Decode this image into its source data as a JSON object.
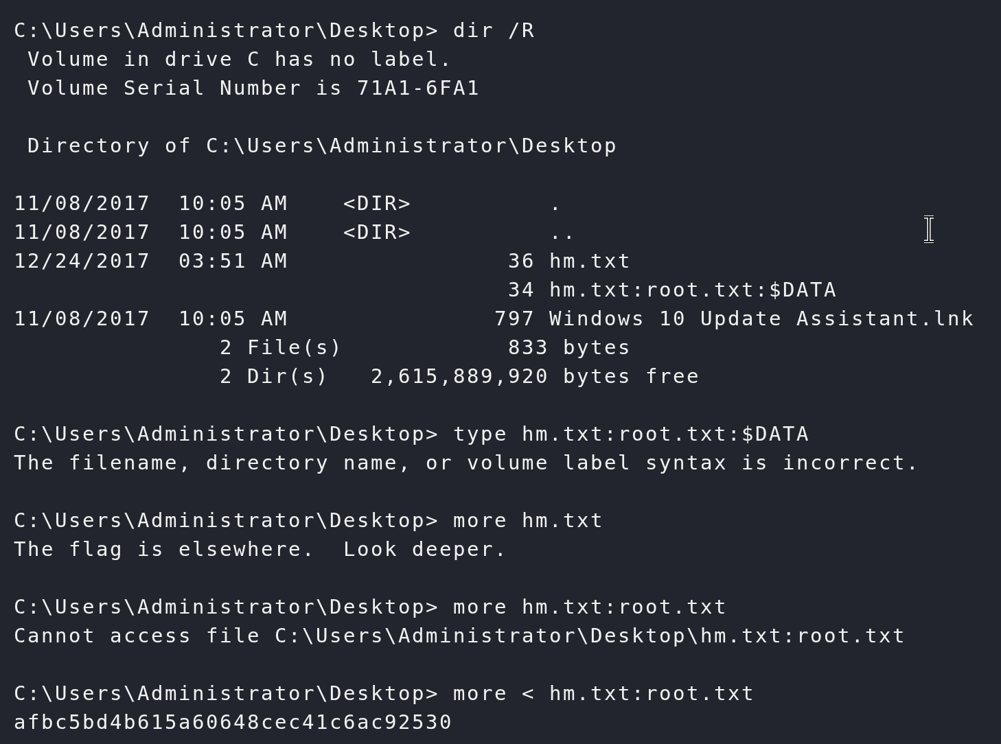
{
  "terminal": {
    "blocks": [
      [
        "C:\\Users\\Administrator\\Desktop> dir /R",
        " Volume in drive C has no label.",
        " Volume Serial Number is 71A1-6FA1"
      ],
      [
        " Directory of C:\\Users\\Administrator\\Desktop"
      ],
      [
        "11/08/2017  10:05 AM    <DIR>          .",
        "11/08/2017  10:05 AM    <DIR>          ..",
        "12/24/2017  03:51 AM                36 hm.txt",
        "                                    34 hm.txt:root.txt:$DATA",
        "11/08/2017  10:05 AM               797 Windows 10 Update Assistant.lnk",
        "               2 File(s)            833 bytes",
        "               2 Dir(s)   2,615,889,920 bytes free"
      ],
      [
        "C:\\Users\\Administrator\\Desktop> type hm.txt:root.txt:$DATA",
        "The filename, directory name, or volume label syntax is incorrect."
      ],
      [
        "C:\\Users\\Administrator\\Desktop> more hm.txt",
        "The flag is elsewhere.  Look deeper."
      ],
      [
        "C:\\Users\\Administrator\\Desktop> more hm.txt:root.txt",
        "Cannot access file C:\\Users\\Administrator\\Desktop\\hm.txt:root.txt"
      ],
      [
        "C:\\Users\\Administrator\\Desktop> more < hm.txt:root.txt",
        "afbc5bd4b615a60648cec41c6ac92530"
      ]
    ]
  }
}
